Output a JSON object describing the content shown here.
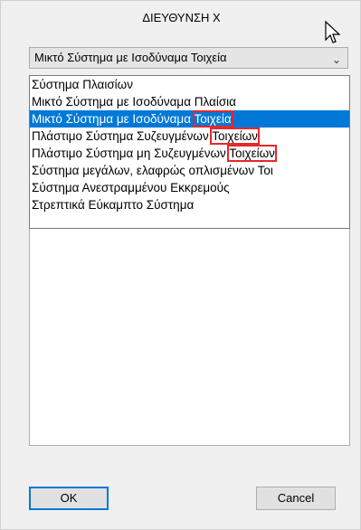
{
  "dialog": {
    "title": "ΔΙΕΥΘΥΝΣΗ Χ"
  },
  "combo": {
    "selected_value": "Μικτό Σύστημα με Ισοδύναμα Τοιχεία",
    "chevron_icon": "chevron-down-icon"
  },
  "dropdown": {
    "options": [
      {
        "label": "Σύστημα Πλαισίων"
      },
      {
        "label": "Μικτό Σύστημα με Ισοδύναμα Πλαίσια"
      },
      {
        "label_a": "Μικτό Σύστημα με Ισοδύναμα",
        "label_b": "Τοιχεία"
      },
      {
        "label_a": "Πλάστιμο Σύστημα Συζευγμένων",
        "label_b": "Τοιχείων"
      },
      {
        "label_a": "Πλάστιμο Σύστημα μη Συζευγμένων",
        "label_b": "Τοιχείων"
      },
      {
        "label": "Σύστημα μεγάλων, ελαφρώς οπλισμένων Τοι"
      },
      {
        "label": "Σύστημα Ανεστραμμένου Εκκρεμούς"
      },
      {
        "label": "Στρεπτικά Εύκαμπτο Σύστημα"
      }
    ],
    "selected_index": 2,
    "highlight_color": "#e8262d",
    "selection_color": "#0078d7"
  },
  "buttons": {
    "ok_label": "OK",
    "cancel_label": "Cancel"
  }
}
